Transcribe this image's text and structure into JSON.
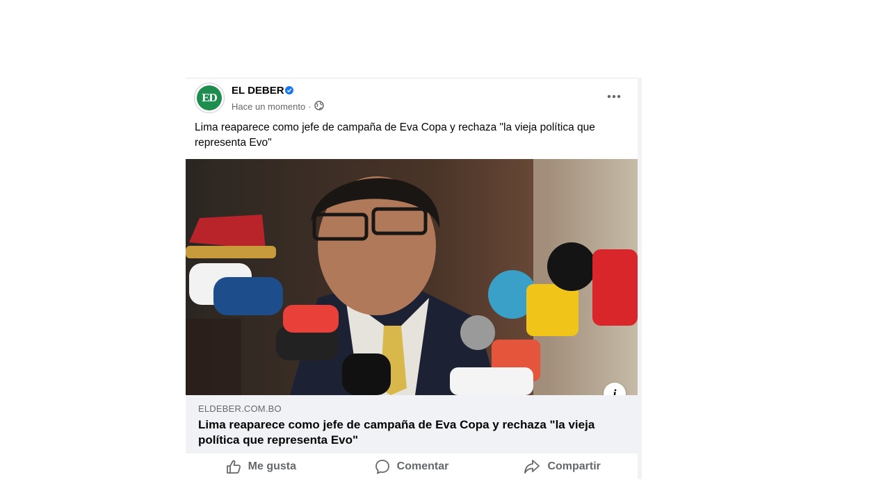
{
  "post": {
    "page_name": "EL DEBER",
    "avatar_text": "ED",
    "timestamp": "Hace un momento",
    "separator": "·",
    "text": "Lima reaparece como jefe de campaña de Eva Copa y rechaza \"la vieja política que representa Evo\"",
    "verified_icon": "verified-badge-icon",
    "audience_icon": "globe-icon"
  },
  "link_preview": {
    "domain": "ELDEBER.COM.BO",
    "title": "Lima reaparece como jefe de campaña de Eva Copa y rechaza \"la vieja política que representa Evo\"",
    "info_label": "i"
  },
  "actions": {
    "like": "Me gusta",
    "comment": "Comentar",
    "share": "Compartir"
  },
  "colors": {
    "brand_blue": "#1877f2",
    "avatar_green": "#1e8e4f",
    "secondary_text": "#65676b",
    "link_box_bg": "#f0f2f5"
  }
}
